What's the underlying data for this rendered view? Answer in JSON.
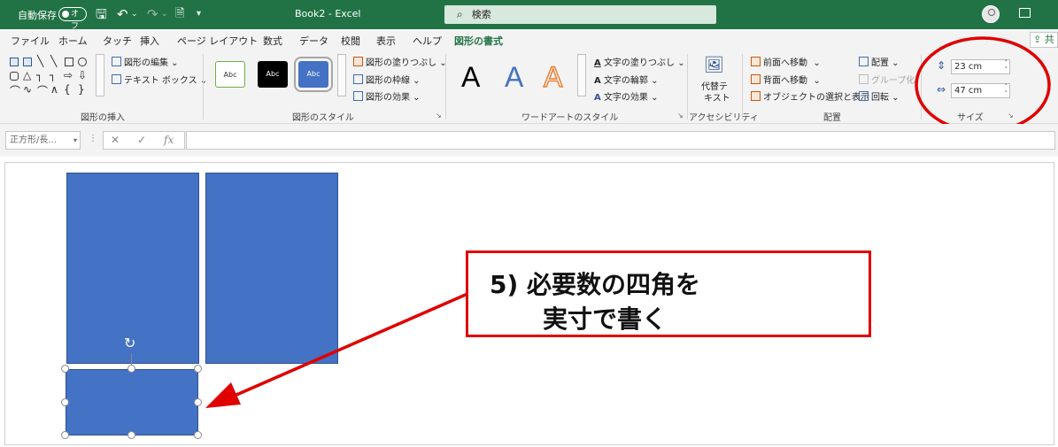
{
  "titlebar": {
    "autosave_label": "自動保存",
    "autosave_state": "オフ",
    "doc_title": "Book2  -  Excel",
    "search_placeholder": "検索"
  },
  "tabs": [
    {
      "label": "ファイル"
    },
    {
      "label": "ホーム"
    },
    {
      "label": "タッチ"
    },
    {
      "label": "挿入"
    },
    {
      "label": "ページ レイアウト"
    },
    {
      "label": "数式"
    },
    {
      "label": "データ"
    },
    {
      "label": "校閲"
    },
    {
      "label": "表示"
    },
    {
      "label": "ヘルプ"
    },
    {
      "label": "図形の書式",
      "active": true
    }
  ],
  "share_label": "共",
  "ribbon": {
    "insert_shapes": {
      "edit_shape": "図形の編集",
      "text_box": "テキスト ボックス",
      "label": "図形の挿入"
    },
    "shape_styles": {
      "presets": [
        "Abc",
        "Abc",
        "Abc"
      ],
      "fill": "図形の塗りつぶし",
      "outline": "図形の枠線",
      "effects": "図形の効果",
      "label": "図形のスタイル"
    },
    "wordart": {
      "letters": [
        "A",
        "A",
        "A"
      ],
      "text_fill": "文字の塗りつぶし",
      "text_outline": "文字の輪郭",
      "text_effects": "文字の効果",
      "label": "ワードアートのスタイル"
    },
    "accessibility": {
      "alt_text_line1": "代替テ",
      "alt_text_line2": "キスト",
      "label": "アクセシビリティ"
    },
    "arrange": {
      "bring_forward": "前面へ移動",
      "send_backward": "背面へ移動",
      "selection_pane": "オブジェクトの選択と表示",
      "align": "配置",
      "group": "グループ化",
      "rotate": "回転",
      "label": "配置"
    },
    "size": {
      "height": "23 cm",
      "width": "47 cm",
      "label": "サイズ"
    }
  },
  "formulabar": {
    "name_box": "正方形/長..."
  },
  "annotation": {
    "line1": "5) 必要数の四角を",
    "line2": "実寸で書く"
  },
  "colors": {
    "excel_green": "#217346",
    "shape_fill": "#4472c4",
    "highlight_red": "#e00000"
  }
}
